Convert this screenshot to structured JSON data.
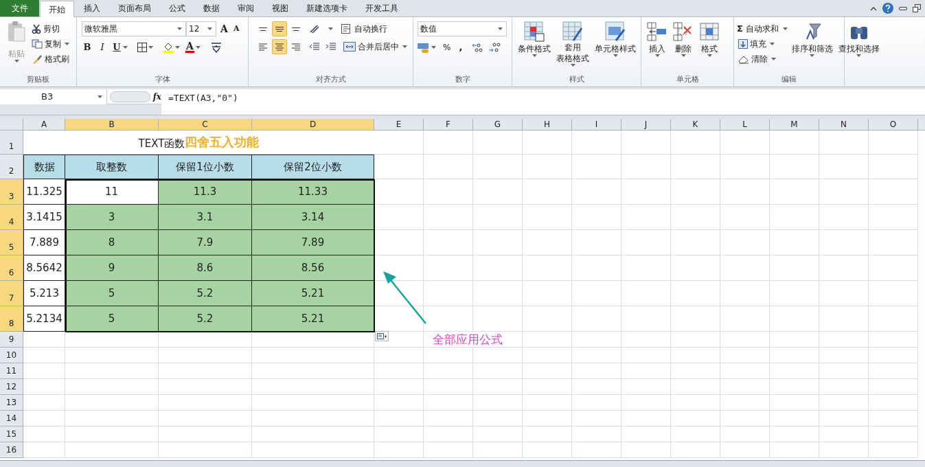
{
  "ribbon_tabs": [
    {
      "label": "文件",
      "kind": "file",
      "selected": false
    },
    {
      "label": "开始",
      "kind": "tab",
      "selected": true
    },
    {
      "label": "插入",
      "kind": "tab",
      "selected": false
    },
    {
      "label": "页面布局",
      "kind": "tab",
      "selected": false
    },
    {
      "label": "公式",
      "kind": "tab",
      "selected": false
    },
    {
      "label": "数据",
      "kind": "tab",
      "selected": false
    },
    {
      "label": "审阅",
      "kind": "tab",
      "selected": false
    },
    {
      "label": "视图",
      "kind": "tab",
      "selected": false
    },
    {
      "label": "新建选项卡",
      "kind": "tab",
      "selected": false
    },
    {
      "label": "开发工具",
      "kind": "tab",
      "selected": false
    }
  ],
  "clipboard": {
    "title": "剪贴板",
    "paste": "粘贴",
    "cut": "剪切",
    "copy": "复制",
    "format_painter": "格式刷"
  },
  "font": {
    "title": "字体",
    "font_name": "微软雅黑",
    "font_size": "12",
    "grow": "A",
    "shrink": "A",
    "bold": "B",
    "italic": "I",
    "underline": "U",
    "font_color": "A"
  },
  "alignment": {
    "title": "对齐方式",
    "vertical": [
      {
        "selected": false
      },
      {
        "selected": true
      },
      {
        "selected": false
      }
    ],
    "horizontal": [
      {
        "selected": false
      },
      {
        "selected": true
      },
      {
        "selected": false
      }
    ],
    "wrap_text": "自动换行",
    "merge_center": "合并后居中"
  },
  "number": {
    "title": "数字",
    "format": "数值",
    "percent": "%",
    "comma": ","
  },
  "styles": {
    "title": "样式",
    "conditional": "条件格式",
    "table_lines": [
      "套用",
      "表格格式"
    ],
    "cell_styles": "单元格样式"
  },
  "cells": {
    "title": "单元格",
    "insert": "插入",
    "delete": "删除",
    "format": "格式"
  },
  "editing": {
    "title": "编辑",
    "sigma": "Σ",
    "autosum": "自动求和",
    "fill": "填充",
    "clear": "清除",
    "sort_filter": "排序和筛选",
    "find_select": "查找和选择"
  },
  "formula_bar": {
    "name_box": "B3",
    "fx": "fx",
    "formula": "=TEXT(A3,\"0\")"
  },
  "columns": [
    {
      "label": "A",
      "selected": false
    },
    {
      "label": "B",
      "selected": true
    },
    {
      "label": "C",
      "selected": true
    },
    {
      "label": "D",
      "selected": true
    },
    {
      "label": "E",
      "selected": false
    },
    {
      "label": "F",
      "selected": false
    },
    {
      "label": "G",
      "selected": false
    },
    {
      "label": "H",
      "selected": false
    },
    {
      "label": "I",
      "selected": false
    },
    {
      "label": "J",
      "selected": false
    },
    {
      "label": "K",
      "selected": false
    },
    {
      "label": "L",
      "selected": false
    },
    {
      "label": "M",
      "selected": false
    },
    {
      "label": "N",
      "selected": false
    },
    {
      "label": "O",
      "selected": false
    }
  ],
  "title_row": {
    "row": "1",
    "text": "TEXT函数",
    "highlight": "四舍五入功能"
  },
  "rows": [
    {
      "row": "2",
      "selected": false,
      "cells": [
        {
          "text": "数据",
          "color": "#b7dde8"
        },
        {
          "text": "取整数",
          "color": "#b7dde8"
        },
        {
          "text": "保留1位小数",
          "color": "#b7dde8"
        },
        {
          "text": "保留2位小数",
          "color": "#b7dde8"
        }
      ]
    },
    {
      "row": "3",
      "selected": true,
      "cells": [
        {
          "text": "11.325",
          "color": "#ffffff"
        },
        {
          "text": "11",
          "color": "#ffffff"
        },
        {
          "text": "11.3",
          "color": "#a6d3a2"
        },
        {
          "text": "11.33",
          "color": "#a6d3a2"
        }
      ]
    },
    {
      "row": "4",
      "selected": true,
      "cells": [
        {
          "text": "3.1415",
          "color": "#ffffff"
        },
        {
          "text": "3",
          "color": "#a6d3a2"
        },
        {
          "text": "3.1",
          "color": "#a6d3a2"
        },
        {
          "text": "3.14",
          "color": "#a6d3a2"
        }
      ]
    },
    {
      "row": "5",
      "selected": true,
      "cells": [
        {
          "text": "7.889",
          "color": "#ffffff"
        },
        {
          "text": "8",
          "color": "#a6d3a2"
        },
        {
          "text": "7.9",
          "color": "#a6d3a2"
        },
        {
          "text": "7.89",
          "color": "#a6d3a2"
        }
      ]
    },
    {
      "row": "6",
      "selected": true,
      "cells": [
        {
          "text": "8.5642",
          "color": "#ffffff"
        },
        {
          "text": "9",
          "color": "#a6d3a2"
        },
        {
          "text": "8.6",
          "color": "#a6d3a2"
        },
        {
          "text": "8.56",
          "color": "#a6d3a2"
        }
      ]
    },
    {
      "row": "7",
      "selected": true,
      "cells": [
        {
          "text": "5.213",
          "color": "#ffffff"
        },
        {
          "text": "5",
          "color": "#a6d3a2"
        },
        {
          "text": "5.2",
          "color": "#a6d3a2"
        },
        {
          "text": "5.21",
          "color": "#a6d3a2"
        }
      ]
    },
    {
      "row": "8",
      "selected": true,
      "cells": [
        {
          "text": "5.2134",
          "color": "#ffffff"
        },
        {
          "text": "5",
          "color": "#a6d3a2"
        },
        {
          "text": "5.2",
          "color": "#a6d3a2"
        },
        {
          "text": "5.21",
          "color": "#a6d3a2"
        }
      ]
    }
  ],
  "empty_rows": [
    {
      "row": "9",
      "selected": false
    },
    {
      "row": "10",
      "selected": false
    },
    {
      "row": "11",
      "selected": false
    },
    {
      "row": "12",
      "selected": false
    },
    {
      "row": "13",
      "selected": false
    },
    {
      "row": "14",
      "selected": false
    },
    {
      "row": "15",
      "selected": false
    },
    {
      "row": "16",
      "selected": false
    }
  ],
  "annotation": {
    "text": "全部应用公式"
  }
}
